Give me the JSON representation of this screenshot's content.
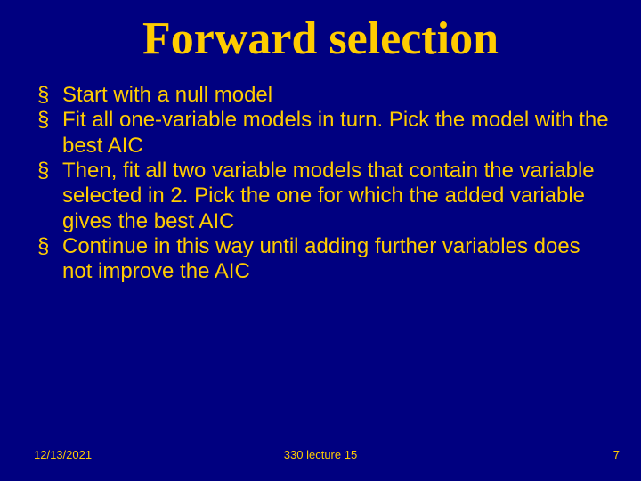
{
  "title": "Forward selection",
  "bullets": [
    "Start with a null model",
    "Fit all one-variable models in turn. Pick the model with the best AIC",
    "Then, fit all two variable models that contain the variable selected in 2. Pick the one for which the added variable gives the best AIC",
    "Continue in this way until adding further variables does not improve the AIC"
  ],
  "footer": {
    "date": "12/13/2021",
    "center": "330 lecture 15",
    "page": "7"
  }
}
